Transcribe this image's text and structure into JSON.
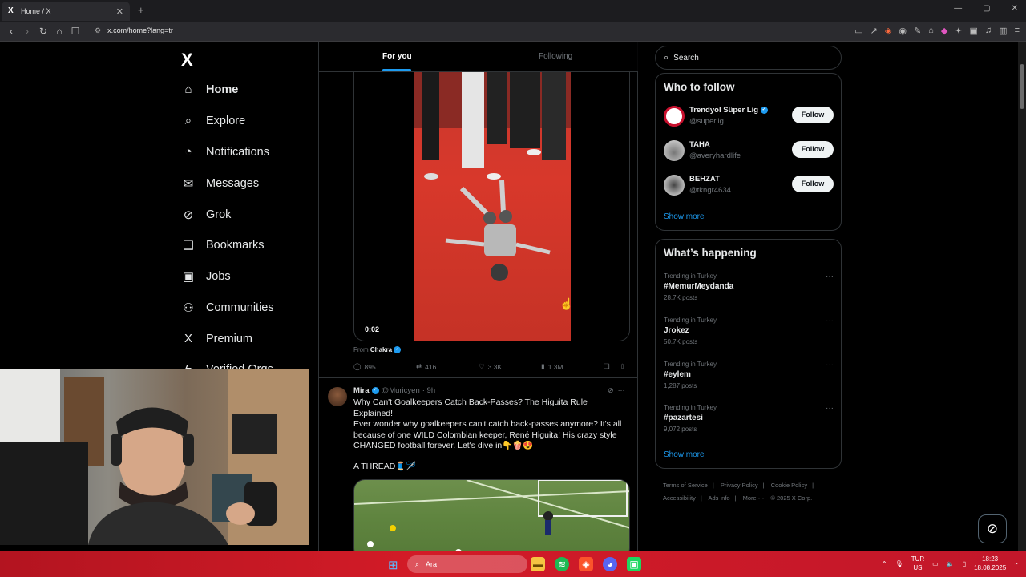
{
  "browser": {
    "tab_title": "Home / X",
    "tab_close": "✕",
    "new_tab": "+",
    "url": "x.com/home?lang=tr",
    "window_controls": [
      "—",
      "▢",
      "✕"
    ]
  },
  "nav": {
    "logo": "X",
    "items": [
      {
        "label": "Home",
        "icon": "home-icon",
        "glyph": "⌂"
      },
      {
        "label": "Explore",
        "icon": "search-icon",
        "glyph": "⌕"
      },
      {
        "label": "Notifications",
        "icon": "bell-icon",
        "glyph": "◔"
      },
      {
        "label": "Messages",
        "icon": "mail-icon",
        "glyph": "✉"
      },
      {
        "label": "Grok",
        "icon": "grok-icon",
        "glyph": "⊘"
      },
      {
        "label": "Bookmarks",
        "icon": "bookmark-icon",
        "glyph": "❑"
      },
      {
        "label": "Jobs",
        "icon": "briefcase-icon",
        "glyph": "▣"
      },
      {
        "label": "Communities",
        "icon": "people-icon",
        "glyph": "⚇"
      },
      {
        "label": "Premium",
        "icon": "x-icon",
        "glyph": "X"
      },
      {
        "label": "Verified Orgs",
        "icon": "lightning-icon",
        "glyph": "ϟ"
      }
    ]
  },
  "feed": {
    "tabs": {
      "for_you": "For you",
      "following": "Following"
    },
    "tweet1": {
      "video_time": "0:02",
      "from_prefix": "From",
      "from_name": "Chakra",
      "replies": "895",
      "reposts": "416",
      "likes": "3.3K",
      "views": "1.3M"
    },
    "tweet2": {
      "name": "Mira",
      "handle": "@Muricyen",
      "time": "· 9h",
      "line1": "Why Can't Goalkeepers Catch Back-Passes? The Higuita Rule Explained!",
      "line2": "Ever wonder why goalkeepers can't catch back-passes anymore?  It's all because of one WILD Colombian keeper, René Higuita!  His crazy style CHANGED football forever. Let's dive in👇🍿😍",
      "line3": "A THREAD🧵🪡"
    }
  },
  "sidebar": {
    "search_placeholder": "Search",
    "who_to_follow": {
      "title": "Who to follow",
      "accounts": [
        {
          "name": "Trendyol Süper Lig",
          "handle": "@superlig",
          "button": "Follow",
          "avatar_color": "#c8102e"
        },
        {
          "name": "TAHA",
          "handle": "@averyhardlife",
          "button": "Follow",
          "avatar_color": "#e0e0e0"
        },
        {
          "name": "BEHZAT",
          "handle": "@tkngr4634",
          "button": "Follow",
          "avatar_color": "#d9d9d9"
        }
      ],
      "show_more": "Show more"
    },
    "whats_happening": {
      "title": "What’s happening",
      "trends": [
        {
          "category": "Trending in Turkey",
          "name": "#MemurMeydanda",
          "posts": "28.7K posts"
        },
        {
          "category": "Trending in Turkey",
          "name": "Jrokez",
          "posts": "50.7K posts"
        },
        {
          "category": "Trending in Turkey",
          "name": "#eylem",
          "posts": "1,287 posts"
        },
        {
          "category": "Trending in Turkey",
          "name": "#pazartesi",
          "posts": "9,072 posts"
        }
      ],
      "more_glyph": "···",
      "show_more": "Show more"
    },
    "footer": {
      "links": [
        "Terms of Service",
        "|",
        "Privacy Policy",
        "|",
        "Cookie Policy",
        "|",
        "Accessibility",
        "|",
        "Ads info",
        "|",
        "More ···",
        "© 2025 X Corp."
      ]
    }
  },
  "taskbar": {
    "search_label": "Ara",
    "lang_top": "TUR",
    "lang_bottom": "US",
    "time": "18:23",
    "date": "18.08.2025"
  }
}
